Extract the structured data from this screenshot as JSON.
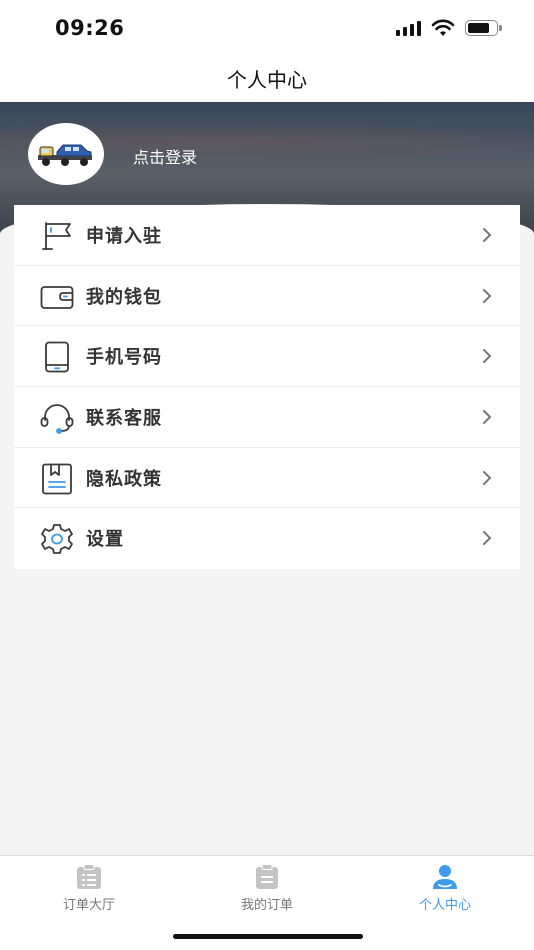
{
  "status": {
    "time": "09:26"
  },
  "nav": {
    "title": "个人中心"
  },
  "profile": {
    "login_label": "点击登录"
  },
  "menu": {
    "items": [
      {
        "label": "申请入驻",
        "icon": "flag-icon"
      },
      {
        "label": "我的钱包",
        "icon": "wallet-icon"
      },
      {
        "label": "手机号码",
        "icon": "tablet-phone-icon"
      },
      {
        "label": "联系客服",
        "icon": "headset-icon"
      },
      {
        "label": "隐私政策",
        "icon": "bookmark-document-icon"
      },
      {
        "label": "设置",
        "icon": "gear-icon"
      }
    ]
  },
  "tabs": [
    {
      "label": "订单大厅",
      "icon": "clipboard-list-icon",
      "active": false
    },
    {
      "label": "我的订单",
      "icon": "clipboard-icon",
      "active": false
    },
    {
      "label": "个人中心",
      "icon": "user-icon",
      "active": true
    }
  ],
  "colors": {
    "accent": "#3d9be9",
    "icon_stroke": "#3b3b3b"
  }
}
